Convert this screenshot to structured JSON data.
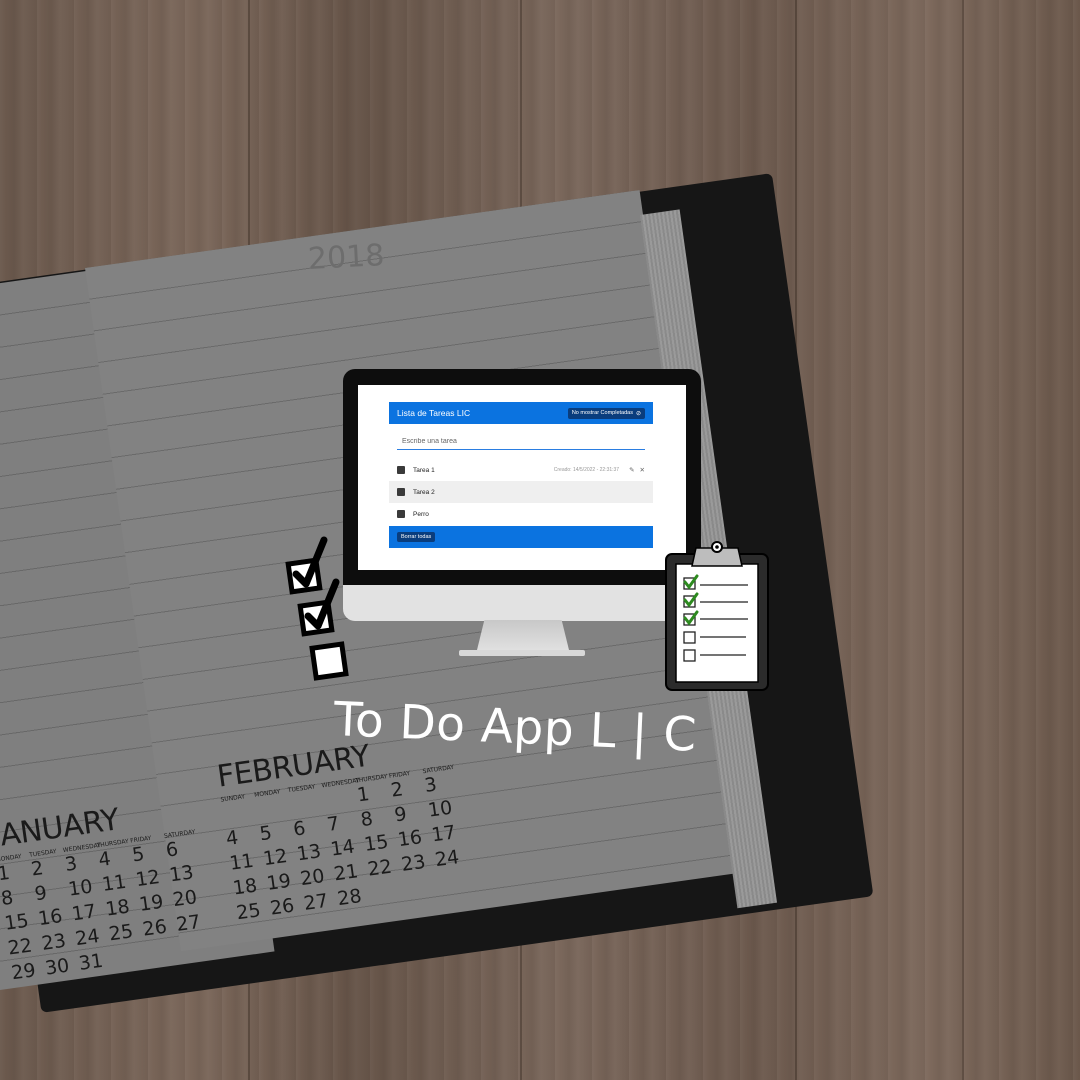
{
  "notebook": {
    "year": "2018",
    "february": {
      "month": "FEBRUARY",
      "weekdays": [
        "SUNDAY",
        "MONDAY",
        "TUESDAY",
        "WEDNESDAY",
        "THURSDAY",
        "FRIDAY",
        "SATURDAY"
      ],
      "rows": [
        [
          "",
          "",
          "",
          "",
          "1",
          "2",
          "3"
        ],
        [
          "4",
          "5",
          "6",
          "7",
          "8",
          "9",
          "10"
        ],
        [
          "11",
          "12",
          "13",
          "14",
          "15",
          "16",
          "17"
        ],
        [
          "18",
          "19",
          "20",
          "21",
          "22",
          "23",
          "24"
        ],
        [
          "25",
          "26",
          "27",
          "28",
          "",
          "",
          ""
        ]
      ]
    },
    "january": {
      "month": "JANUARY",
      "weekdays": [
        "MONDAY",
        "TUESDAY",
        "WEDNESDAY",
        "THURSDAY",
        "FRIDAY",
        "SATURDAY"
      ],
      "rows": [
        [
          "1",
          "2",
          "3",
          "4",
          "5",
          "6"
        ],
        [
          "8",
          "9",
          "10",
          "11",
          "12",
          "13"
        ],
        [
          "15",
          "16",
          "17",
          "18",
          "19",
          "20"
        ],
        [
          "22",
          "23",
          "24",
          "25",
          "26",
          "27"
        ],
        [
          "29",
          "30",
          "31",
          "",
          "",
          ""
        ]
      ]
    }
  },
  "app": {
    "title": "Lista de Tareas LIC",
    "hide_completed_label": "No mostrar Completadas",
    "input_placeholder": "Escribe una tarea",
    "tasks": [
      {
        "label": "Tarea 1",
        "meta": "Creado: 14/5/2022 - 22:31:37"
      },
      {
        "label": "Tarea 2",
        "meta": ""
      },
      {
        "label": "Perro",
        "meta": ""
      }
    ],
    "clear_all_label": "Borrar todas",
    "accent": "#0b73e0",
    "button_color": "#0a3d7d"
  },
  "caption": "To Do App L | C"
}
